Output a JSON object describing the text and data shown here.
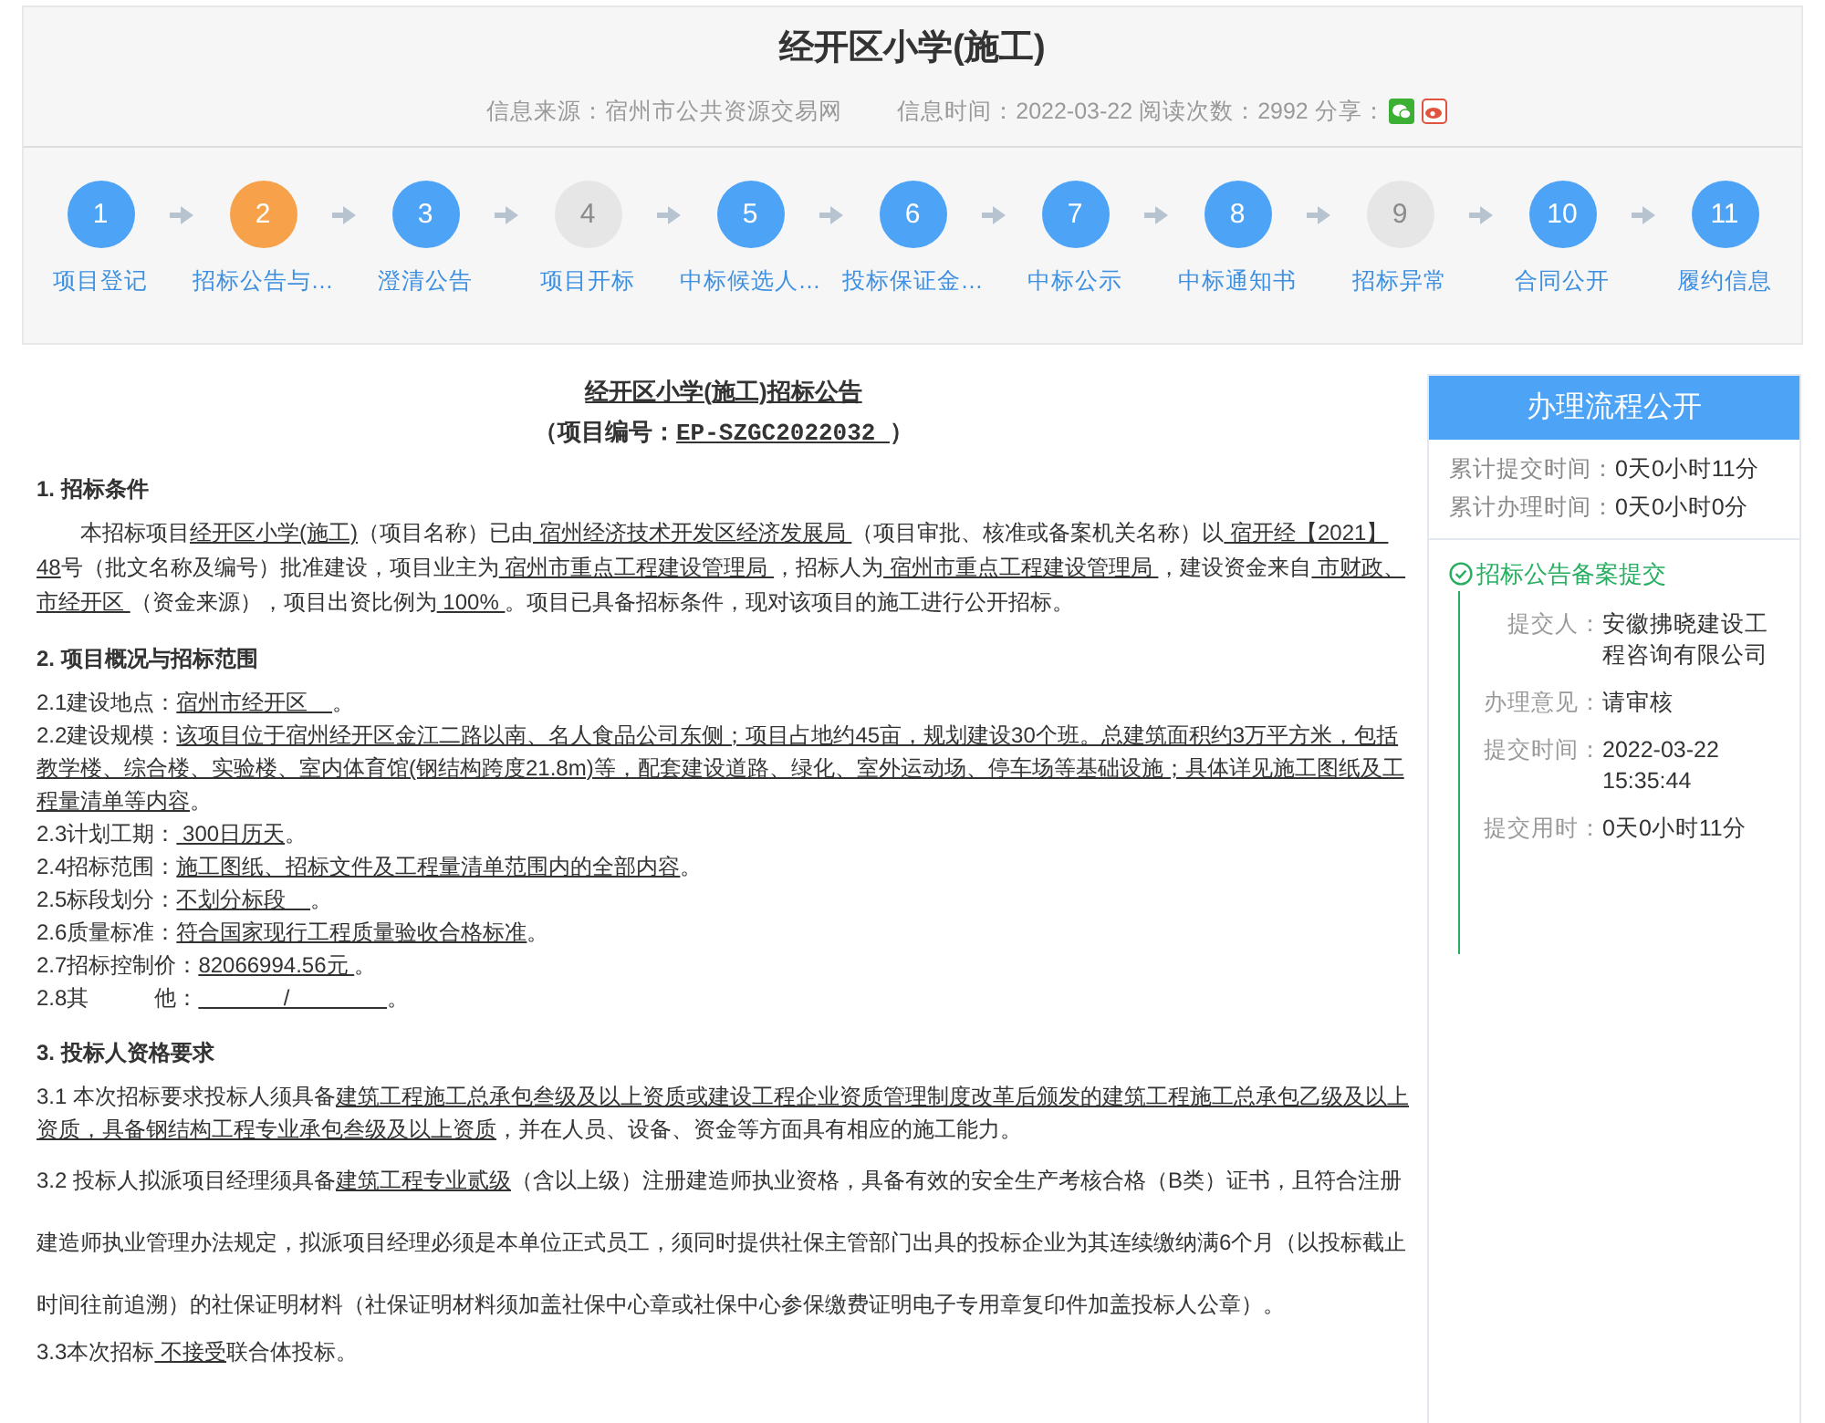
{
  "header": {
    "title": "经开区小学(施工)",
    "source_label": "信息来源：",
    "source": "宿州市公共资源交易网",
    "time_label": "信息时间：",
    "time": "2022-03-22",
    "reads_label": "阅读次数：",
    "reads": "2992",
    "share_label": "分享："
  },
  "steps": [
    {
      "number": "1",
      "label": "项目登记",
      "selected": false,
      "disabled": false
    },
    {
      "number": "2",
      "label": "招标公告与…",
      "selected": true,
      "disabled": false
    },
    {
      "number": "3",
      "label": "澄清公告",
      "selected": false,
      "disabled": false
    },
    {
      "number": "4",
      "label": "项目开标",
      "selected": false,
      "disabled": true
    },
    {
      "number": "5",
      "label": "中标候选人…",
      "selected": false,
      "disabled": false
    },
    {
      "number": "6",
      "label": "投标保证金…",
      "selected": false,
      "disabled": false
    },
    {
      "number": "7",
      "label": "中标公示",
      "selected": false,
      "disabled": false
    },
    {
      "number": "8",
      "label": "中标通知书",
      "selected": false,
      "disabled": false
    },
    {
      "number": "9",
      "label": "招标异常",
      "selected": false,
      "disabled": true
    },
    {
      "number": "10",
      "label": "合同公开",
      "selected": false,
      "disabled": false
    },
    {
      "number": "11",
      "label": "履约信息",
      "selected": false,
      "disabled": false
    }
  ],
  "document": {
    "title": "经开区小学(施工)招标公告",
    "code_label": "（项目编号：",
    "code": "EP-SZGC2022032 ",
    "code_end": "）",
    "sections": [
      {
        "heading": "1. 招标条件",
        "paragraphs": [
          {
            "kind": "indent",
            "segments": [
              {
                "text": "本招标项目",
                "u": false
              },
              {
                "text": "经开区小学(施工)",
                "u": true
              },
              {
                "text": "（项目名称）已由",
                "u": false
              },
              {
                "text": " 宿州经济技术开发区经济发展局 ",
                "u": true
              },
              {
                "text": "（项目审批、核准或备案机关名称）以",
                "u": false
              },
              {
                "text": " 宿开经【2021】48",
                "u": true
              },
              {
                "text": "号（批文名称及编号）批准建设，项目业主为",
                "u": false
              },
              {
                "text": " 宿州市重点工程建设管理局 ",
                "u": true
              },
              {
                "text": "，招标人为",
                "u": false
              },
              {
                "text": " 宿州市重点工程建设管理局 ",
                "u": true
              },
              {
                "text": "，建设资金来自",
                "u": false
              },
              {
                "text": " 市财政、市经开区 ",
                "u": true
              },
              {
                "text": "（资金来源），项目出资比例为",
                "u": false
              },
              {
                "text": " 100% ",
                "u": true
              },
              {
                "text": "。项目已具备招标条件，现对该项目的施工进行公开招标。",
                "u": false
              }
            ]
          }
        ]
      },
      {
        "heading": "2. 项目概况与招标范围",
        "paragraphs": [
          {
            "kind": "item",
            "segments": [
              {
                "text": "2.1建设地点：",
                "u": false
              },
              {
                "text": "宿州市经开区    ",
                "u": true
              },
              {
                "text": "。",
                "u": false
              }
            ]
          },
          {
            "kind": "item",
            "segments": [
              {
                "text": "2.2建设规模：",
                "u": false
              },
              {
                "text": "该项目位于宿州经开区金江二路以南、名人食品公司东侧；项目占地约45亩，规划建设30个班。总建筑面积约3万平方米，包括教学楼、综合楼、实验楼、室内体育馆(钢结构跨度21.8m)等，配套建设道路、绿化、室外运动场、停车场等基础设施；具体详见施工图纸及工程量清单等内容",
                "u": true
              },
              {
                "text": "。",
                "u": false
              }
            ]
          },
          {
            "kind": "item",
            "segments": [
              {
                "text": "2.3计划工期：",
                "u": false
              },
              {
                "text": " 300日历天",
                "u": true
              },
              {
                "text": "。",
                "u": false
              }
            ]
          },
          {
            "kind": "item",
            "segments": [
              {
                "text": "2.4招标范围：",
                "u": false
              },
              {
                "text": "施工图纸、招标文件及工程量清单范围内的全部内容",
                "u": true
              },
              {
                "text": "。",
                "u": false
              }
            ]
          },
          {
            "kind": "item",
            "segments": [
              {
                "text": "2.5标段划分：",
                "u": false
              },
              {
                "text": "不划分标段    ",
                "u": true
              },
              {
                "text": "。",
                "u": false
              }
            ]
          },
          {
            "kind": "item",
            "segments": [
              {
                "text": "2.6质量标准：",
                "u": false
              },
              {
                "text": "符合国家现行工程质量验收合格标准",
                "u": true
              },
              {
                "text": "。",
                "u": false
              }
            ]
          },
          {
            "kind": "item",
            "segments": [
              {
                "text": "2.7招标控制价：",
                "u": false
              },
              {
                "text": "82066994.56元 ",
                "u": true
              },
              {
                "text": "。",
                "u": false
              }
            ]
          },
          {
            "kind": "item",
            "segments": [
              {
                "text": "2.8其　　　他：",
                "u": false
              },
              {
                "text": "              /                ",
                "u": true
              },
              {
                "text": "。",
                "u": false
              }
            ]
          }
        ]
      },
      {
        "heading": "3. 投标人资格要求",
        "paragraphs": [
          {
            "kind": "item",
            "segments": [
              {
                "text": "3.1 本次招标要求投标人须具备",
                "u": false
              },
              {
                "text": "建筑工程施工总承包叁级及以上资质或建设工程企业资质管理制度改革后颁发的建筑工程施工总承包乙级及以上资质，具备钢结构工程专业承包叁级及以上资质",
                "u": true
              },
              {
                "text": "，并在人员、设备、资金等方面具有相应的施工能力。",
                "u": false
              }
            ]
          },
          {
            "kind": "wide",
            "segments": [
              {
                "text": "3.2 投标人拟派项目经理须具备",
                "u": false
              },
              {
                "text": "建筑工程专业贰级",
                "u": true
              },
              {
                "text": "（含以上级）注册建造师执业资格，具备有效的安全生产考核合格（B类）证书，且符合注册建造师执业管理办法规定，拟派项目经理必须是本单位正式员工，须同时提供社保主管部门出具的投标企业为其连续缴纳满6个月（以投标截止时间往前追溯）的社保证明材料（社保证明材料须加盖社保中心章或社保中心参保缴费证明电子专用章复印件加盖投标人公章）。",
                "u": false
              }
            ]
          },
          {
            "kind": "item",
            "segments": [
              {
                "text": "3.3本次招标",
                "u": false
              },
              {
                "text": " 不接受",
                "u": true
              },
              {
                "text": "联合体投标。",
                "u": false
              }
            ]
          }
        ]
      }
    ]
  },
  "sidebar": {
    "title": "办理流程公开",
    "totals": [
      {
        "label": "累计提交时间：",
        "value": "0天0小时11分"
      },
      {
        "label": "累计办理时间：",
        "value": "0天0小时0分"
      }
    ],
    "event": {
      "title": "招标公告备案提交",
      "fields": [
        {
          "label": "提交人：",
          "value": "安徽拂晓建设工程咨询有限公司"
        },
        {
          "label": "办理意见：",
          "value": "请审核"
        },
        {
          "label": "提交时间：",
          "value": "2022-03-22 15:35:44"
        },
        {
          "label": "提交用时：",
          "value": "0天0小时11分"
        }
      ]
    }
  }
}
